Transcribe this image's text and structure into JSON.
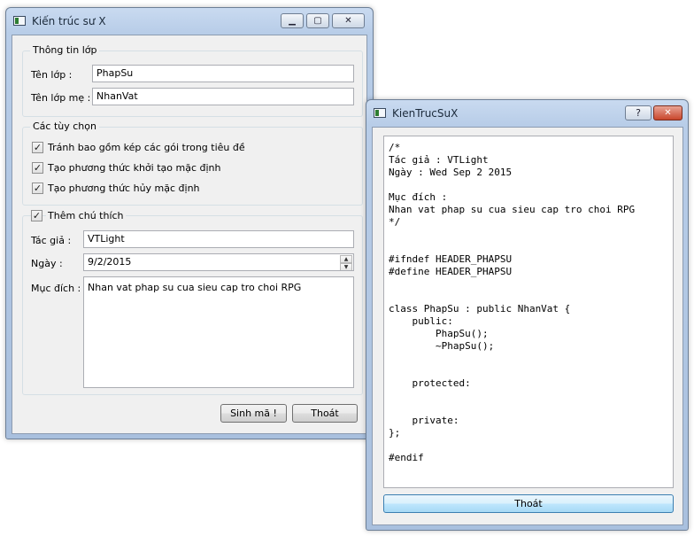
{
  "main_window": {
    "title": "Kiến trúc sư X",
    "class_group": {
      "legend": "Thông tin lớp",
      "class_name_label": "Tên lớp :",
      "class_name_value": "PhapSu",
      "parent_class_label": "Tên lớp mẹ :",
      "parent_class_value": "NhanVat"
    },
    "options_group": {
      "legend": "Các tùy chọn",
      "options": [
        {
          "label": "Tránh bao gồm kép các gói trong tiêu đề",
          "checked": true
        },
        {
          "label": "Tạo phương thức khởi tạo mặc định",
          "checked": true
        },
        {
          "label": "Tạo phương thức hủy mặc định",
          "checked": true
        }
      ]
    },
    "comment_group": {
      "legend": "Thêm chú thích",
      "checked": true,
      "author_label": "Tác giả :",
      "author_value": "VTLight",
      "date_label": "Ngày :",
      "date_value": "9/2/2015",
      "purpose_label": "Mục đích :",
      "purpose_value": "Nhan vat phap su cua sieu cap tro choi RPG"
    },
    "generate_button": "Sinh mã !",
    "quit_button": "Thoát"
  },
  "code_window": {
    "title": "KienTrucSuX",
    "help_button": "?",
    "code": "/*\nTác giả : VTLight\nNgày : Wed Sep 2 2015\n\nMục đích :\nNhan vat phap su cua sieu cap tro choi RPG\n*/\n\n\n#ifndef HEADER_PHAPSU\n#define HEADER_PHAPSU\n\n\nclass PhapSu : public NhanVat {\n    public:\n        PhapSu();\n        ~PhapSu();\n\n\n    protected:\n\n\n    private:\n};\n\n#endif",
    "quit_button": "Thoát"
  },
  "colors": {
    "title_bar": "#b8cde8",
    "client_bg": "#f0f0f0",
    "close_button": "#c9462c"
  }
}
